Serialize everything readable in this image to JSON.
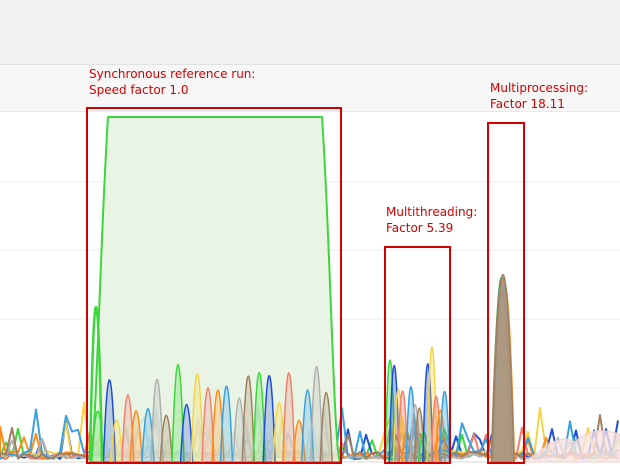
{
  "annotations": [
    {
      "line1": "Synchronous reference run:",
      "line2": "Speed factor 1.0"
    },
    {
      "line1": "Multithreading:",
      "line2": "Factor 5.39"
    },
    {
      "line1": "Multiprocessing:",
      "line2": "Factor 18.11"
    }
  ],
  "colors": {
    "annotation": "#d40000",
    "series": [
      "#3dd63d",
      "#1f4fd6",
      "#f5d547",
      "#f08070",
      "#ff8c1a",
      "#3aa0e0",
      "#b0b0b0",
      "#a08060"
    ]
  },
  "chart_data": {
    "type": "area",
    "title": "",
    "xlabel": "",
    "ylabel": "",
    "grid": true,
    "regions": [
      {
        "label": "Synchronous reference run",
        "speed_factor": 1.0
      },
      {
        "label": "Multithreading",
        "speed_factor": 5.39
      },
      {
        "label": "Multiprocessing",
        "speed_factor": 18.11
      }
    ]
  }
}
